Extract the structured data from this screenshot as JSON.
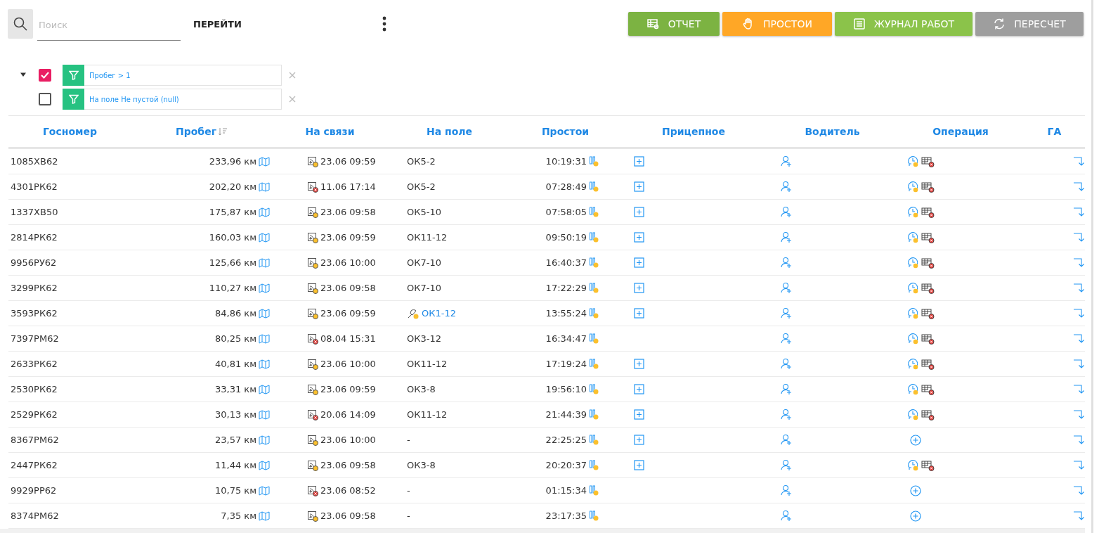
{
  "search": {
    "placeholder": "Поиск"
  },
  "go_button": "ПЕРЕЙТИ",
  "actions": [
    {
      "label": "ОТЧЕТ",
      "kind": "report"
    },
    {
      "label": "ПРОСТОИ",
      "kind": "idle"
    },
    {
      "label": "ЖУРНАЛ РАБОТ",
      "kind": "log"
    },
    {
      "label": "ПЕРЕСЧЕТ",
      "kind": "recalc"
    }
  ],
  "filters": {
    "expanded": true,
    "items": [
      {
        "text": "Пробег > 1",
        "checked": true
      },
      {
        "text": "На поле Не пустой (null)",
        "checked": false
      }
    ]
  },
  "table": {
    "columns": [
      {
        "label": "Госномер",
        "sorted": false
      },
      {
        "label": "Пробег",
        "sorted": true
      },
      {
        "label": "На связи",
        "sorted": false
      },
      {
        "label": "На поле",
        "sorted": false
      },
      {
        "label": "Простои",
        "sorted": false
      },
      {
        "label": "Прицепное",
        "sorted": false
      },
      {
        "label": "Водитель",
        "sorted": false
      },
      {
        "label": "Операция",
        "sorted": false
      },
      {
        "label": "ГА",
        "sorted": false
      }
    ],
    "rows": [
      {
        "plate": "1085ХВ62",
        "mileage": "233,96 км",
        "signal_lost": false,
        "link_time": "23.06 09:59",
        "field": "ОК5-2",
        "field_flagged": false,
        "idle": "10:19:31",
        "trailer": true,
        "has_operation": true
      },
      {
        "plate": "4301РК62",
        "mileage": "202,20 км",
        "signal_lost": true,
        "link_time": "11.06 17:14",
        "field": "ОК5-2",
        "field_flagged": false,
        "idle": "07:28:49",
        "trailer": true,
        "has_operation": true
      },
      {
        "plate": "1337ХВ50",
        "mileage": "175,87 км",
        "signal_lost": false,
        "link_time": "23.06 09:58",
        "field": "ОК5-10",
        "field_flagged": false,
        "idle": "07:58:05",
        "trailer": true,
        "has_operation": true
      },
      {
        "plate": "2814РК62",
        "mileage": "160,03 км",
        "signal_lost": false,
        "link_time": "23.06 09:59",
        "field": "ОК11-12",
        "field_flagged": false,
        "idle": "09:50:19",
        "trailer": true,
        "has_operation": true
      },
      {
        "plate": "9956РУ62",
        "mileage": "125,66 км",
        "signal_lost": false,
        "link_time": "23.06 10:00",
        "field": "ОК7-10",
        "field_flagged": false,
        "idle": "16:40:37",
        "trailer": true,
        "has_operation": true
      },
      {
        "plate": "3299РК62",
        "mileage": "110,27 км",
        "signal_lost": false,
        "link_time": "23.06 09:58",
        "field": "ОК7-10",
        "field_flagged": false,
        "idle": "17:22:29",
        "trailer": true,
        "has_operation": true
      },
      {
        "plate": "3593РК62",
        "mileage": "84,86 км",
        "signal_lost": false,
        "link_time": "23.06 09:59",
        "field": "ОК1-12",
        "field_flagged": true,
        "idle": "13:55:24",
        "trailer": true,
        "has_operation": true
      },
      {
        "plate": "7397РМ62",
        "mileage": "80,25 км",
        "signal_lost": true,
        "link_time": "08.04 15:31",
        "field": "ОК3-12",
        "field_flagged": false,
        "idle": "16:34:47",
        "trailer": false,
        "has_operation": true
      },
      {
        "plate": "2633РК62",
        "mileage": "40,81 км",
        "signal_lost": false,
        "link_time": "23.06 10:00",
        "field": "ОК11-12",
        "field_flagged": false,
        "idle": "17:19:24",
        "trailer": true,
        "has_operation": true
      },
      {
        "plate": "2530РК62",
        "mileage": "33,31 км",
        "signal_lost": false,
        "link_time": "23.06 09:59",
        "field": "ОК3-8",
        "field_flagged": false,
        "idle": "19:56:10",
        "trailer": true,
        "has_operation": true
      },
      {
        "plate": "2529РК62",
        "mileage": "30,13 км",
        "signal_lost": true,
        "link_time": "20.06 14:09",
        "field": "ОК11-12",
        "field_flagged": false,
        "idle": "21:44:39",
        "trailer": true,
        "has_operation": true
      },
      {
        "plate": "8367РМ62",
        "mileage": "23,57 км",
        "signal_lost": false,
        "link_time": "23.06 10:00",
        "field": "-",
        "field_flagged": false,
        "idle": "22:25:25",
        "trailer": true,
        "has_operation": false
      },
      {
        "plate": "2447РК62",
        "mileage": "11,44 км",
        "signal_lost": false,
        "link_time": "23.06 09:58",
        "field": "ОК3-8",
        "field_flagged": false,
        "idle": "20:20:37",
        "trailer": true,
        "has_operation": true
      },
      {
        "plate": "9929РР62",
        "mileage": "10,75 км",
        "signal_lost": true,
        "link_time": "23.06 08:52",
        "field": "-",
        "field_flagged": false,
        "idle": "01:15:34",
        "trailer": false,
        "has_operation": false
      },
      {
        "plate": "8374РМ62",
        "mileage": "7,35 км",
        "signal_lost": false,
        "link_time": "23.06 09:58",
        "field": "-",
        "field_flagged": false,
        "idle": "23:17:35",
        "trailer": false,
        "has_operation": false
      }
    ]
  }
}
